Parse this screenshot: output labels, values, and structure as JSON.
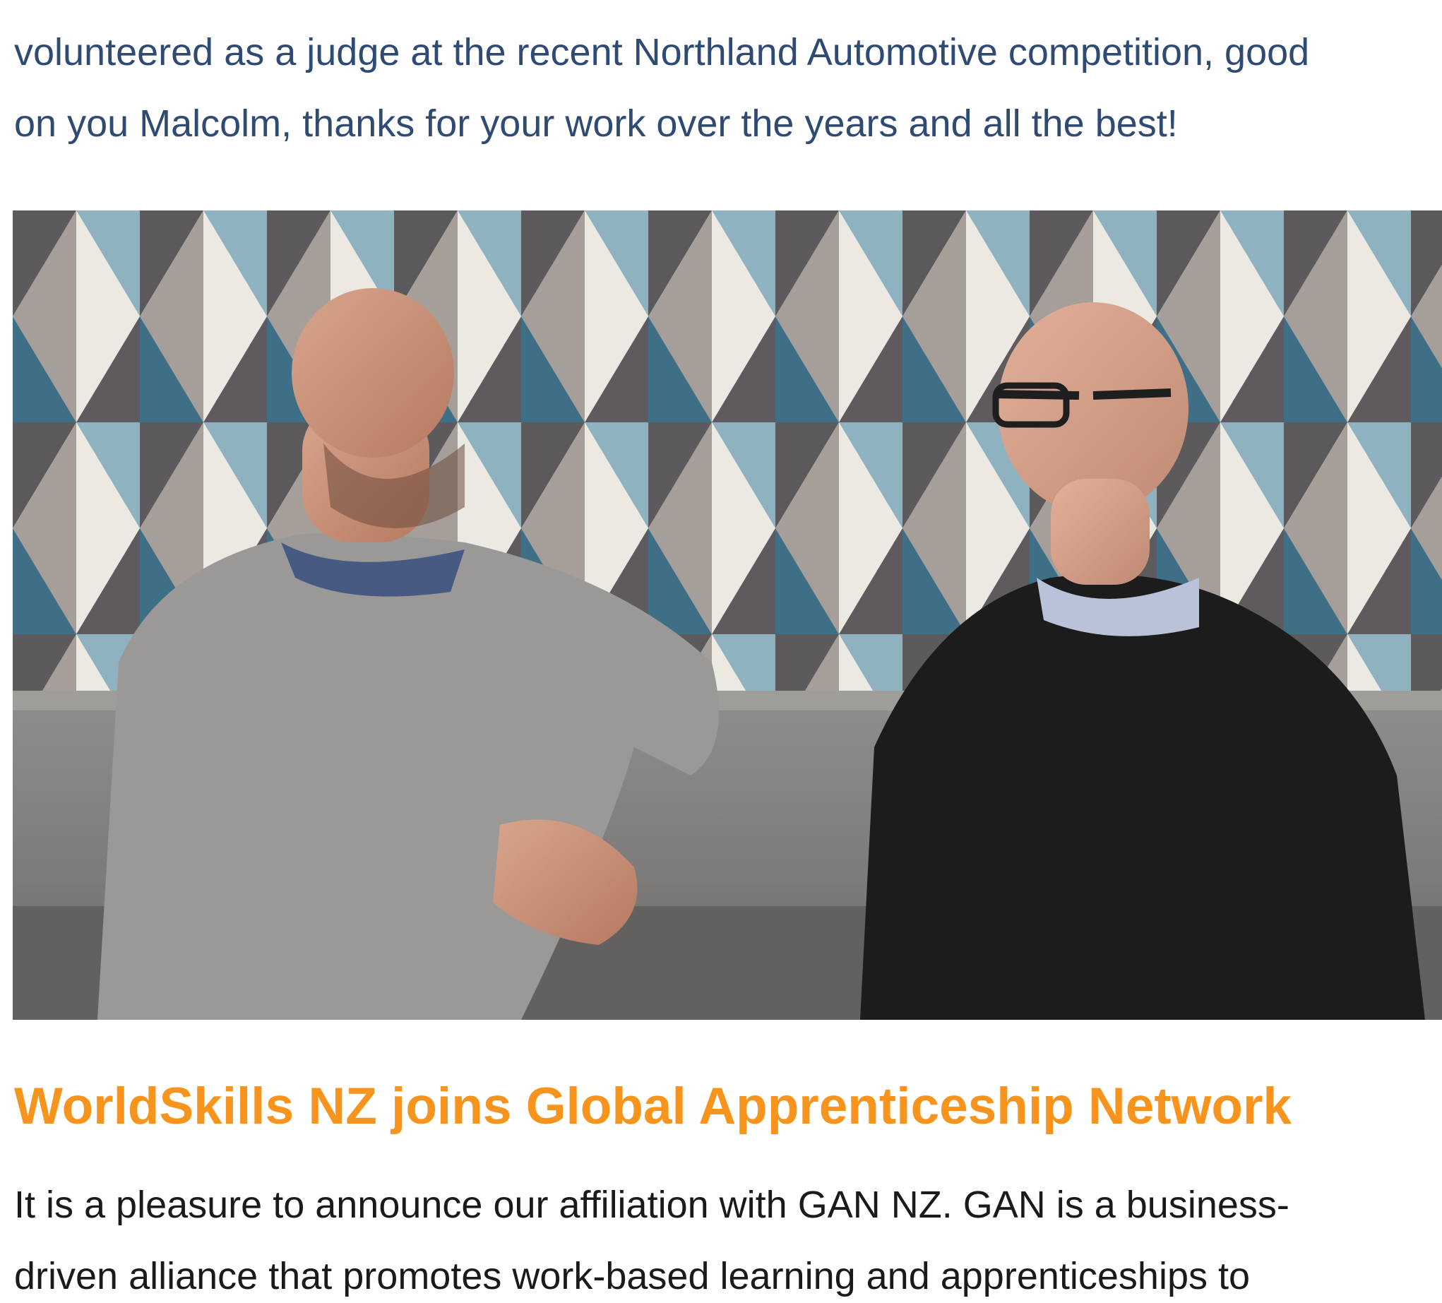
{
  "intro": {
    "text": "volunteered as a judge at the recent Northland Automotive competition, good\non you Malcolm, thanks for your work over the years and all the best!"
  },
  "photo": {
    "description_icon": "photo-two-men-seated-icon"
  },
  "article": {
    "headline": "WorldSkills NZ joins Global Apprenticeship Network",
    "body": "It is a pleasure to announce our affiliation with GAN NZ. GAN is a business-\ndriven alliance that promotes work-based learning and apprenticeships to"
  },
  "colors": {
    "headline": "#f7941d",
    "intro_text": "#2f4a73",
    "body_text": "#1a1a1a"
  }
}
